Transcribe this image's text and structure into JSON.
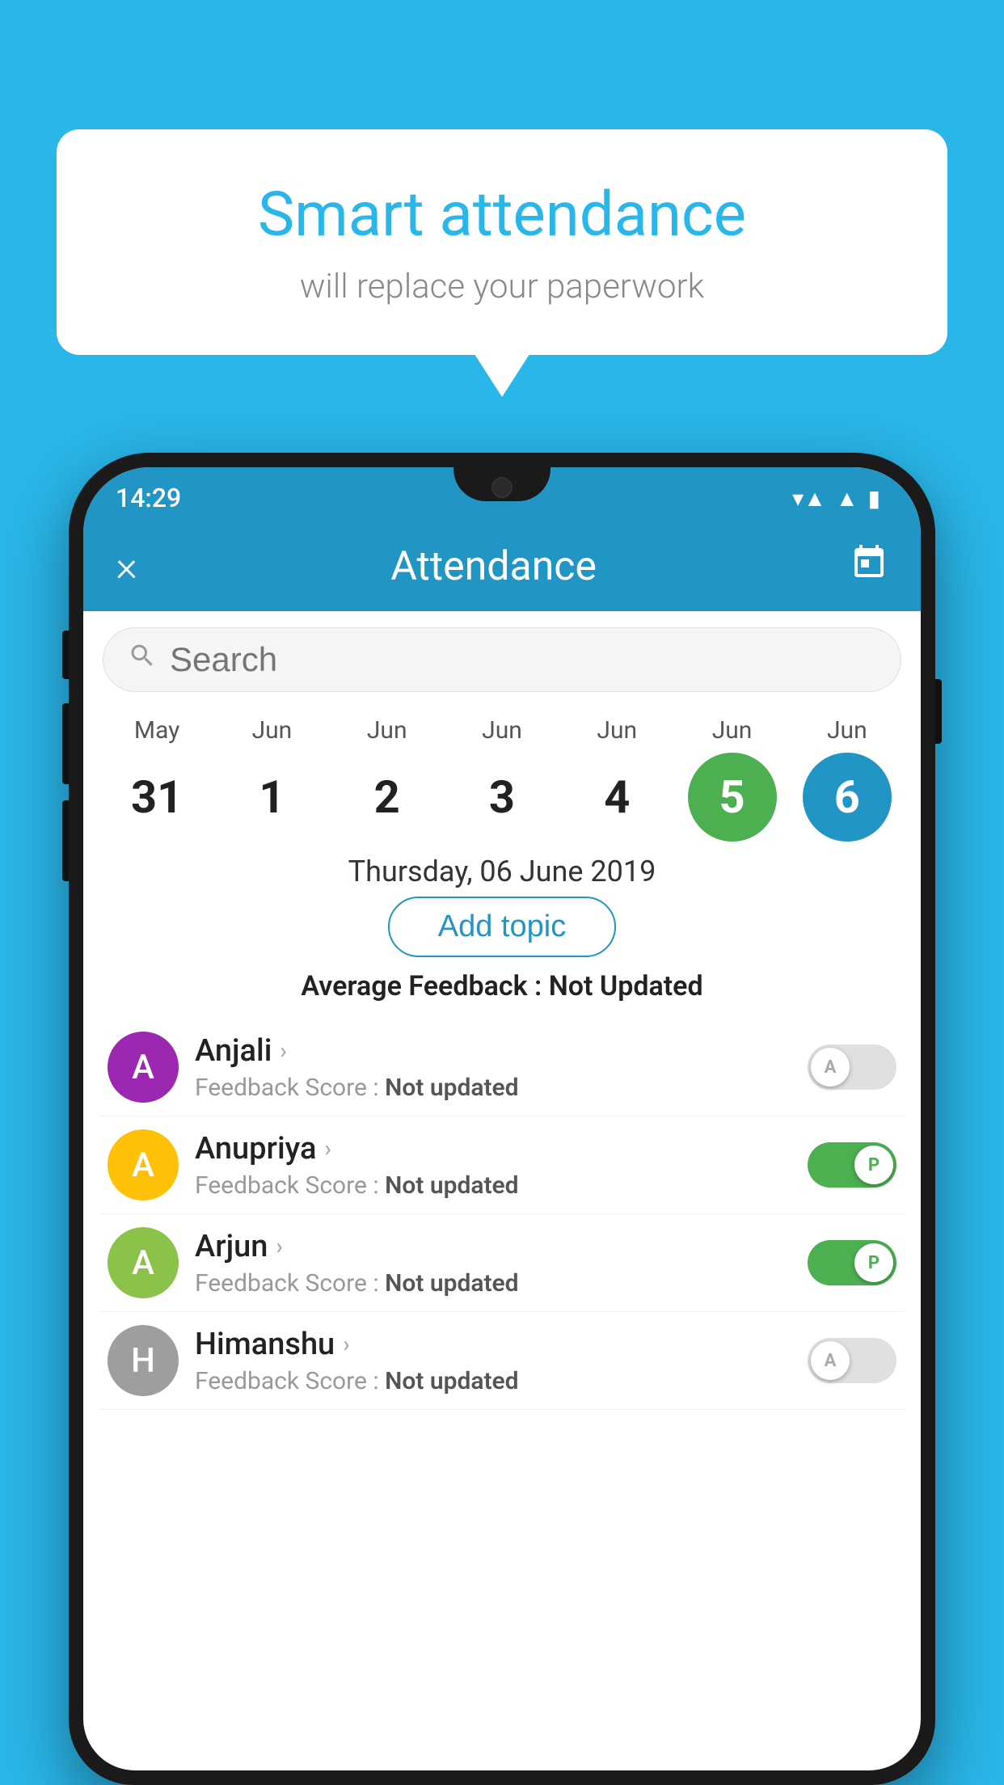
{
  "background_color": "#29b6e8",
  "bubble": {
    "title": "Smart attendance",
    "subtitle": "will replace your paperwork"
  },
  "status_bar": {
    "time": "14:29",
    "icons": [
      "wifi",
      "signal",
      "battery"
    ]
  },
  "app_bar": {
    "close_label": "×",
    "title": "Attendance",
    "calendar_icon": "📅"
  },
  "search": {
    "placeholder": "Search"
  },
  "calendar": {
    "days": [
      {
        "month": "May",
        "date": "31",
        "style": "normal"
      },
      {
        "month": "Jun",
        "date": "1",
        "style": "normal"
      },
      {
        "month": "Jun",
        "date": "2",
        "style": "normal"
      },
      {
        "month": "Jun",
        "date": "3",
        "style": "normal"
      },
      {
        "month": "Jun",
        "date": "4",
        "style": "normal"
      },
      {
        "month": "Jun",
        "date": "5",
        "style": "today"
      },
      {
        "month": "Jun",
        "date": "6",
        "style": "selected"
      }
    ],
    "selected_date_label": "Thursday, 06 June 2019"
  },
  "add_topic_label": "Add topic",
  "avg_feedback": {
    "label": "Average Feedback : ",
    "value": "Not Updated"
  },
  "students": [
    {
      "name": "Anjali",
      "avatar_letter": "A",
      "avatar_color": "#9c27b0",
      "feedback": "Not updated",
      "toggle_state": "off",
      "toggle_label": "A"
    },
    {
      "name": "Anupriya",
      "avatar_letter": "A",
      "avatar_color": "#ffc107",
      "feedback": "Not updated",
      "toggle_state": "on",
      "toggle_label": "P"
    },
    {
      "name": "Arjun",
      "avatar_letter": "A",
      "avatar_color": "#8bc34a",
      "feedback": "Not updated",
      "toggle_state": "on",
      "toggle_label": "P"
    },
    {
      "name": "Himanshu",
      "avatar_letter": "H",
      "avatar_color": "#9e9e9e",
      "feedback": "Not updated",
      "toggle_state": "off",
      "toggle_label": "A"
    }
  ],
  "feedback_label": "Feedback Score : "
}
